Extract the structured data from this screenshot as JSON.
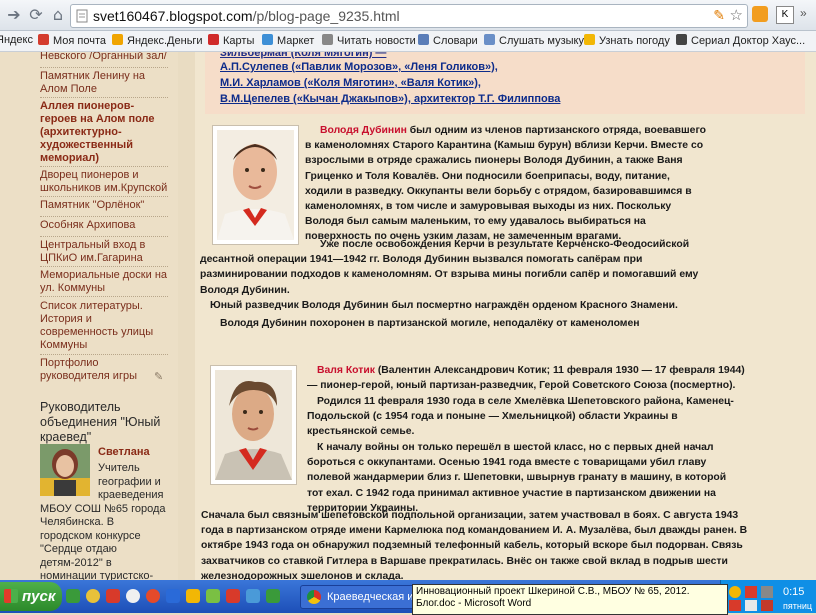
{
  "browser": {
    "url_host": "svet160467.blogspot.com",
    "url_path": "/p/blog-page_9235.html"
  },
  "bookmarks": [
    "Яндекс",
    "Моя почта",
    "Яндекс.Деньги",
    "Карты",
    "Маркет",
    "Читать новости",
    "Словари",
    "Слушать музыку",
    "Узнать погоду",
    "Сериал Доктор Хаус..."
  ],
  "sidebar": {
    "links": [
      "Невского /Органный зал/",
      "Памятник Ленину на Алом Поле",
      "Аллея пионеров-героев на Алом поле (архитектурно-художественный мемориал)",
      "Дворец пионеров и школьников им.Крупской",
      "Памятник \"Орлёнок\"",
      "Особняк Архипова",
      "Центральный вход в ЦПКиО им.Гагарина",
      "Мемориальные доски на ул. Коммуны",
      "Список литературы. История и современность улицы Коммуны",
      "Портфолио руководителя игры"
    ],
    "leader_heading": "Руководитель объединения \"Юный краевед\"",
    "leader_name": "Светлана",
    "leader_desc": "Учитель географии и краеведения МБОУ СОШ №65 города Челябинска. В городском конкурсе \"Сердце отдаю детям-2012\" в номинации туристско-краеведческой занятия 2"
  },
  "content": {
    "credits": [
      "А.П.Сулепев («Павлик Морозов», «Леня Голиков»),",
      "М.И. Харламов («Коля Мяготин», «Валя Котик»),",
      "В.М.Цепелев («Кычан Джакыпов»), архитектор Т.Г. Филиппова"
    ],
    "dubinin_name": "Володя Дубинин",
    "dubinin_p1": " был одним из членов партизанского отряда, воевавшего в каменоломнях Старого Карантина (Камыш бурун) вблизи Керчи. Вместе со взрослыми в отряде сражались пионеры Володя Дубинин, а также Ваня Гриценко и Толя Ковалёв. Они подносили боеприпасы, воду, питание, ходили в разведку. Оккупанты вели борьбу с отрядом, базировавшимся в каменоломнях, в том числе и замуровывая выходы из них. Поскольку Володя был самым маленьким, то ему удавалось выбираться на поверхность по очень узким лазам, не замеченным врагами.",
    "dubinin_p2": "Уже после освобождения Керчи в результате Керченско-Феодосийской десантной операции 1941—1942 гг. Володя Дубинин вызвался помогать сапёрам при разминировании подходов к каменоломням. От взрыва мины погибли сапёр и помогавший ему Володя Дубинин.",
    "dubinin_p3": "Юный разведчик Володя Дубинин был посмертно награждён орденом Красного Знамени.",
    "dubinin_p4": "Володя Дубинин похоронен в партизанской могиле, неподалёку от каменоломен",
    "kotik_name": "Валя Котик",
    "kotik_p1": " (Валентин Александрович Котик; 11 февраля 1930 — 17 февраля 1944) — пионер-герой, юный партизан-разведчик, Герой Советского Союза (посмертно).",
    "kotik_p2": "Родился 11 февраля 1930 года в селе Хмелёвка Шепетовского района, Каменец-Подольской (с 1954 года и поныне — Хмельницкой) области Украины в крестьянской семье.",
    "kotik_p3": "К началу войны он только перешёл в шестой класс, но с первых дней начал бороться с оккупантами. Осенью 1941 года вместе с товарищами убил главу полевой жандармерии близ г. Шепетовки, швырнув гранату в машину, в которой тот ехал. С 1942 года принимал активное участие в партизанском движении на территории Украины.",
    "kotik_p4": "Сначала был связным шепетовской подпольной организации, затем участвовал в боях. С августа 1943 года в партизанском отряде имени Кармелюка под командованием И. А. Музалёва, был дважды ранен. В октябре 1943 года он обнаружил подземный телефонный кабель, который вскоре был подорван. Связь захватчиков со ставкой Гитлера в Варшаве прекратилась. Внёс он также свой вклад в подрыв шести железнодорожных эшелонов и склада."
  },
  "taskbar": {
    "start_label": "пуск",
    "task1": "Краеведческая игр...",
    "tooltip": "Инновационный проект Шкериной С.В., МБОУ № 65, 2012. Блог.doc - Microsoft Word",
    "time": "0:15",
    "day": "пятниц"
  }
}
